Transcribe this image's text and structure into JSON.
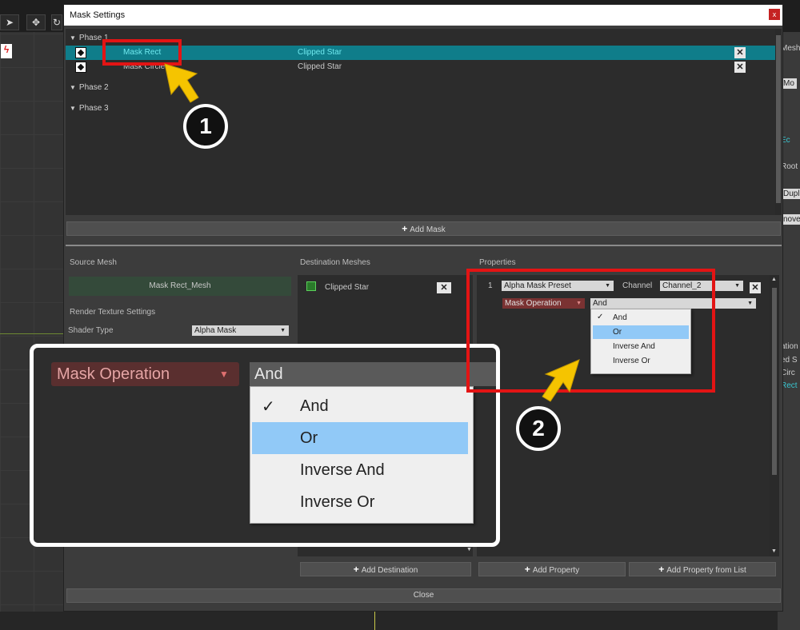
{
  "dialog": {
    "title": "Mask Settings",
    "close_glyph": "x",
    "phases": [
      {
        "label": "Phase 1",
        "masks": [
          {
            "name": "Mask Rect",
            "target": "Clipped Star",
            "selected": true
          },
          {
            "name": "Mask Circle",
            "target": "Clipped Star",
            "selected": false
          }
        ]
      },
      {
        "label": "Phase 2",
        "masks": []
      },
      {
        "label": "Phase 3",
        "masks": []
      }
    ],
    "remove_glyph": "✕",
    "add_mask_label": "Add Mask",
    "source_mesh": {
      "header": "Source Mesh",
      "value": "Mask Rect_Mesh",
      "render_settings_label": "Render Texture Settings",
      "shader_type_label": "Shader Type",
      "shader_type_value": "Alpha Mask"
    },
    "destination": {
      "header": "Destination Meshes",
      "items": [
        "Clipped Star"
      ],
      "add_label": "Add Destination"
    },
    "properties": {
      "header": "Properties",
      "index": "1",
      "preset": "Alpha Mask Preset",
      "channel_label": "Channel",
      "channel_value": "Channel_2",
      "operation_label": "Mask Operation",
      "operation_value": "And",
      "add_property_label": "Add Property",
      "add_from_list_label": "Add Property from List"
    },
    "close_label": "Close"
  },
  "operation_menu": {
    "options": [
      "And",
      "Or",
      "Inverse And",
      "Inverse Or"
    ],
    "checked": "And",
    "highlighted": "Or",
    "check_glyph": "✓"
  },
  "callouts": [
    "1",
    "2"
  ],
  "background_right_panel": [
    "Mesh",
    "Mo",
    "Ec",
    "Root",
    "Duplic",
    "nove",
    "ation",
    "ed S",
    "Circ",
    "Rect"
  ],
  "colors": {
    "selection": "#0f7d8a",
    "highlight_text": "#6fe9ef",
    "menu_highlight": "#91c9f7",
    "callout_box": "#e31414",
    "arrow": "#f5c400",
    "operation_bg": "#7a3232"
  }
}
